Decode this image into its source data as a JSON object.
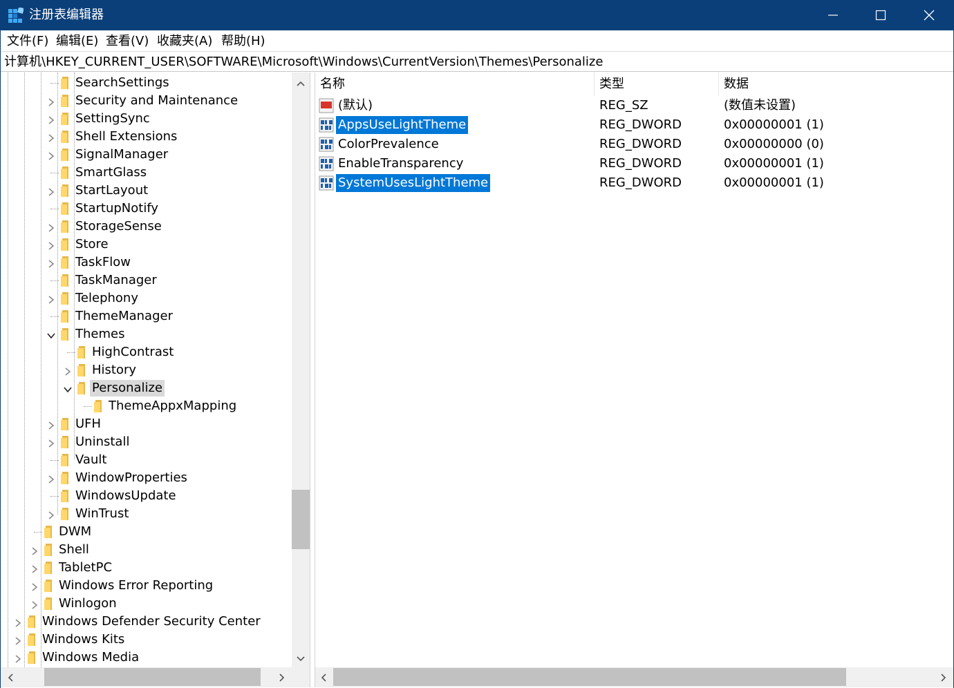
{
  "window": {
    "title": "注册表编辑器",
    "accent_color": "#0b3f79",
    "selection_color": "#0078d7",
    "buttons": [
      "minimize-icon",
      "maximize-icon",
      "close-icon"
    ]
  },
  "menu": {
    "items": [
      {
        "label": "文件(F)"
      },
      {
        "label": "编辑(E)"
      },
      {
        "label": "查看(V)"
      },
      {
        "label": "收藏夹(A)"
      },
      {
        "label": "帮助(H)"
      }
    ]
  },
  "address": {
    "path": "计算机\\HKEY_CURRENT_USER\\SOFTWARE\\Microsoft\\Windows\\CurrentVersion\\Themes\\Personalize"
  },
  "tree": {
    "items": [
      {
        "label": "SearchSettings",
        "expander": "none",
        "selected": false
      },
      {
        "label": "Security and Maintenance",
        "expander": "collapsed",
        "selected": false
      },
      {
        "label": "SettingSync",
        "expander": "collapsed",
        "selected": false
      },
      {
        "label": "Shell Extensions",
        "expander": "collapsed",
        "selected": false
      },
      {
        "label": "SignalManager",
        "expander": "collapsed",
        "selected": false
      },
      {
        "label": "SmartGlass",
        "expander": "none",
        "selected": false
      },
      {
        "label": "StartLayout",
        "expander": "collapsed",
        "selected": false
      },
      {
        "label": "StartupNotify",
        "expander": "none",
        "selected": false
      },
      {
        "label": "StorageSense",
        "expander": "collapsed",
        "selected": false
      },
      {
        "label": "Store",
        "expander": "collapsed",
        "selected": false
      },
      {
        "label": "TaskFlow",
        "expander": "collapsed",
        "selected": false
      },
      {
        "label": "TaskManager",
        "expander": "none",
        "selected": false
      },
      {
        "label": "Telephony",
        "expander": "collapsed",
        "selected": false
      },
      {
        "label": "ThemeManager",
        "expander": "none",
        "selected": false
      },
      {
        "label": "Themes",
        "expander": "expanded",
        "selected": false
      },
      {
        "label": "HighContrast",
        "expander": "none",
        "selected": false
      },
      {
        "label": "History",
        "expander": "collapsed",
        "selected": false
      },
      {
        "label": "Personalize",
        "expander": "expanded",
        "selected": true
      },
      {
        "label": "ThemeAppxMapping",
        "expander": "none",
        "selected": false
      },
      {
        "label": "UFH",
        "expander": "collapsed",
        "selected": false
      },
      {
        "label": "Uninstall",
        "expander": "collapsed",
        "selected": false
      },
      {
        "label": "Vault",
        "expander": "none",
        "selected": false
      },
      {
        "label": "WindowProperties",
        "expander": "collapsed",
        "selected": false
      },
      {
        "label": "WindowsUpdate",
        "expander": "none",
        "selected": false
      },
      {
        "label": "WinTrust",
        "expander": "collapsed",
        "selected": false
      },
      {
        "label": "DWM",
        "expander": "none",
        "selected": false
      },
      {
        "label": "Shell",
        "expander": "collapsed",
        "selected": false
      },
      {
        "label": "TabletPC",
        "expander": "collapsed",
        "selected": false
      },
      {
        "label": "Windows Error Reporting",
        "expander": "collapsed",
        "selected": false
      },
      {
        "label": "Winlogon",
        "expander": "collapsed",
        "selected": false
      },
      {
        "label": "Windows Defender Security Center",
        "expander": "collapsed",
        "selected": false
      },
      {
        "label": "Windows Kits",
        "expander": "collapsed",
        "selected": false
      },
      {
        "label": "Windows Media",
        "expander": "collapsed",
        "selected": false
      }
    ]
  },
  "list": {
    "columns": [
      "名称",
      "类型",
      "数据"
    ],
    "rows": [
      {
        "name": "(默认)",
        "type": "REG_SZ",
        "data": "(数值未设置)",
        "icon": "string-value-icon",
        "selected": false
      },
      {
        "name": "AppsUseLightTheme",
        "type": "REG_DWORD",
        "data": "0x00000001 (1)",
        "icon": "dword-value-icon",
        "selected": true
      },
      {
        "name": "ColorPrevalence",
        "type": "REG_DWORD",
        "data": "0x00000000 (0)",
        "icon": "dword-value-icon",
        "selected": false
      },
      {
        "name": "EnableTransparency",
        "type": "REG_DWORD",
        "data": "0x00000001 (1)",
        "icon": "dword-value-icon",
        "selected": false
      },
      {
        "name": "SystemUsesLightTheme",
        "type": "REG_DWORD",
        "data": "0x00000001 (1)",
        "icon": "dword-value-icon",
        "selected": true
      }
    ]
  }
}
